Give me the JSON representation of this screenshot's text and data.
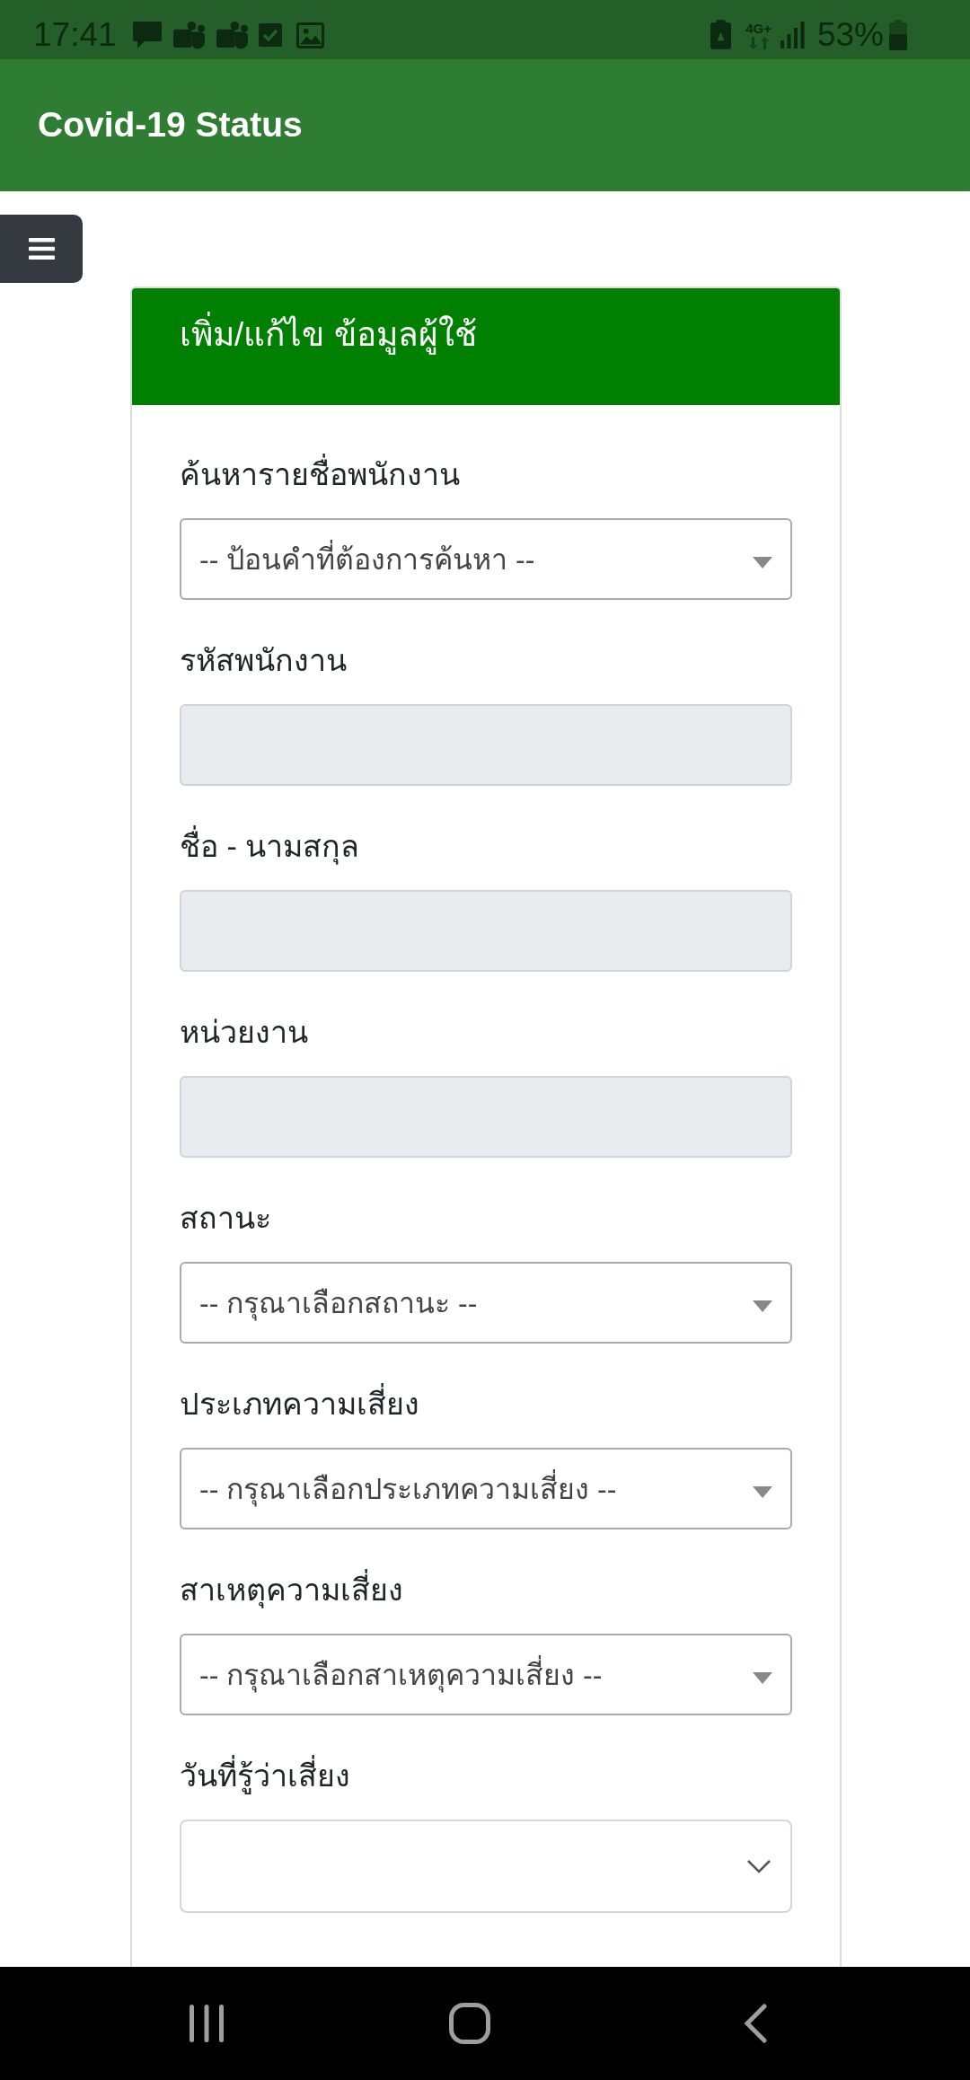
{
  "status_bar": {
    "time": "17:41",
    "network": "4G+",
    "battery": "53%"
  },
  "app_bar": {
    "title": "Covid-19 Status"
  },
  "card": {
    "title": "เพิ่ม/แก้ไข ข้อมูลผู้ใช้",
    "fields": [
      {
        "label": "ค้นหารายชื่อพนักงาน",
        "kind": "select",
        "disabled": false,
        "placeholder": "-- ป้อนคำที่ต้องการค้นหา --"
      },
      {
        "label": "รหัสพนักงาน",
        "kind": "text",
        "disabled": true
      },
      {
        "label": "ชื่อ - นามสกุล",
        "kind": "text",
        "disabled": true
      },
      {
        "label": "หน่วยงาน",
        "kind": "text",
        "disabled": true
      },
      {
        "label": "สถานะ",
        "kind": "select",
        "disabled": false,
        "placeholder": "-- กรุณาเลือกสถานะ --"
      },
      {
        "label": "ประเภทความเสี่ยง",
        "kind": "select",
        "disabled": false,
        "placeholder": "-- กรุณาเลือกประเภทความเสี่ยง --"
      },
      {
        "label": "สาเหตุความเสี่ยง",
        "kind": "select",
        "disabled": false,
        "placeholder": "-- กรุณาเลือกสาเหตุความเสี่ยง --"
      },
      {
        "label": "วันที่รู้ว่าเสี่ยง",
        "kind": "date",
        "disabled": false
      }
    ]
  }
}
